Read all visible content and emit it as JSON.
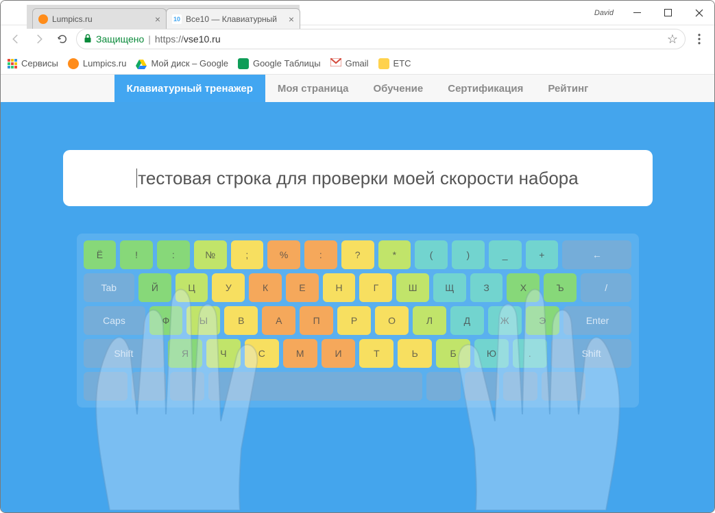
{
  "window": {
    "username": "David",
    "tabs": [
      {
        "title": "Lumpics.ru",
        "favicon": "orange"
      },
      {
        "title": "Все10 — Клавиатурный",
        "favicon": "vse",
        "favtext": "10"
      }
    ]
  },
  "omnibox": {
    "secure_label": "Защищено",
    "url_proto": "https://",
    "url_host": "vse10.ru"
  },
  "bookmarks": {
    "services": "Сервисы",
    "lumpics": "Lumpics.ru",
    "drive": "Мой диск – Google",
    "sheets": "Google Таблицы",
    "gmail": "Gmail",
    "etc": "ETC"
  },
  "sitenav": {
    "trainer": "Клавиатурный тренажер",
    "mypage": "Моя страница",
    "training": "Обучение",
    "cert": "Сертификация",
    "rating": "Рейтинг"
  },
  "typing_text": "тестовая строка для проверки моей скорости набора",
  "keys": {
    "row1": [
      "Ё",
      "!",
      ":",
      "№",
      ";",
      "%",
      ":",
      "?",
      "*",
      "(",
      ")",
      "_",
      "+",
      "←"
    ],
    "row2": [
      "Tab",
      "Й",
      "Ц",
      "У",
      "К",
      "Е",
      "Н",
      "Г",
      "Ш",
      "Щ",
      "З",
      "Х",
      "Ъ",
      "/"
    ],
    "row3": [
      "Caps",
      "Ф",
      "Ы",
      "В",
      "А",
      "П",
      "Р",
      "О",
      "Л",
      "Д",
      "Ж",
      "Э",
      "Enter"
    ],
    "row4": [
      "Shift",
      "Я",
      "Ч",
      "С",
      "М",
      "И",
      "Т",
      "Ь",
      "Б",
      "Ю",
      ".",
      "Shift"
    ],
    "row5": [
      "",
      "",
      "",
      "",
      " ",
      "",
      "",
      "",
      ""
    ]
  }
}
